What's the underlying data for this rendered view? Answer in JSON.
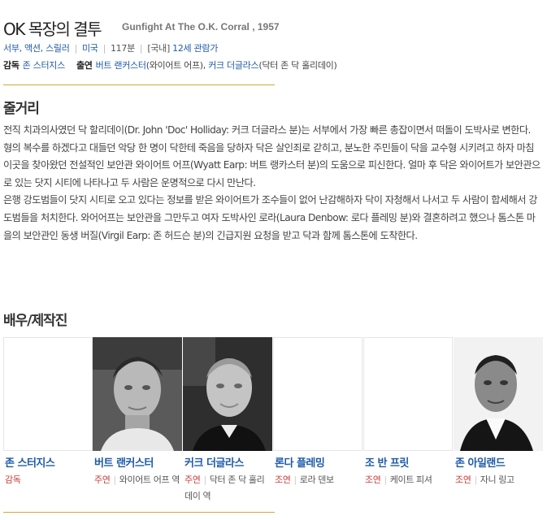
{
  "movie": {
    "title": "OK 목장의 결투",
    "original_title": "Gunfight At The O.K. Corral , 1957"
  },
  "meta": {
    "genres": "서부, 액션, 스릴러",
    "country": "미국",
    "runtime": "117분",
    "rating_prefix": "[국내]",
    "rating": "12세 관람가"
  },
  "credits": {
    "director_label": "감독",
    "director": "존 스터지스",
    "cast_label": "출연",
    "actor1": "버트 랜커스터",
    "role1": "(와이어트 어프), ",
    "actor2": "커크 더글라스",
    "role2": "(닥터 존 닥 홀리데이)"
  },
  "synopsis": {
    "heading": "줄거리",
    "p1": "전직 치과의사였던 닥 할리데이(Dr. John 'Doc' Holliday: 커크 더글라스 분)는 서부에서 가장 빠른 총잡이면서 떠돌이 도박사로 변한다. 형의 복수를 하겠다고 대들던 악당 한 명이 닥한테 죽음을 당하자 닥은 살인죄로 갇히고, 분노한 주민들이 닥을 교수형 시키려고 하자 마침 이곳을 찾아왔던 전설적인 보안관 와이어트 어프(Wyatt Earp: 버트 랭카스터 분)의 도움으로 피신한다. 얼마 후 닥은 와이어트가 보안관으로 있는 닷지 시티에 나타나고 두 사람은 운명적으로 다시 만난다.",
    "p2": "  은행 강도범들이 닷지 시티로 오고 있다는 정보를 받은 와이어트가 조수들이 없어 난감해하자 닥이 자청해서 나서고 두 사람이 합세해서 강도범들을 처치한다. 와어어프는 보안관을 그만두고 여자 도박사인 로라(Laura Denbow: 로다 플레밍 분)와 결혼하려고 했으나 톰스톤 마을의 보안관인 동생 버질(Virgil Earp: 존 허드슨 분)의 긴급지원 요청을 받고 닥과 함께 톰스톤에 도착한다."
  },
  "cast": {
    "heading": "배우/제작진",
    "members": [
      {
        "name": "존 스터지스",
        "role": "감독",
        "character": ""
      },
      {
        "name": "버트 랜커스터",
        "role": "주연",
        "character": "와이어트 어프 역"
      },
      {
        "name": "커크 더글라스",
        "role": "주연",
        "character": "닥터 존 닥 홀리데이 역"
      },
      {
        "name": "론다 플레밍",
        "role": "조연",
        "character": "로라 덴보"
      },
      {
        "name": "조 반 프릿",
        "role": "조연",
        "character": "케이트 피셔"
      },
      {
        "name": "존 아일랜드",
        "role": "조연",
        "character": "자니 링고"
      }
    ]
  },
  "colors": {
    "link": "#1f5ba8",
    "accent_line": "#d4a93a",
    "role_red": "#c93a3a"
  }
}
